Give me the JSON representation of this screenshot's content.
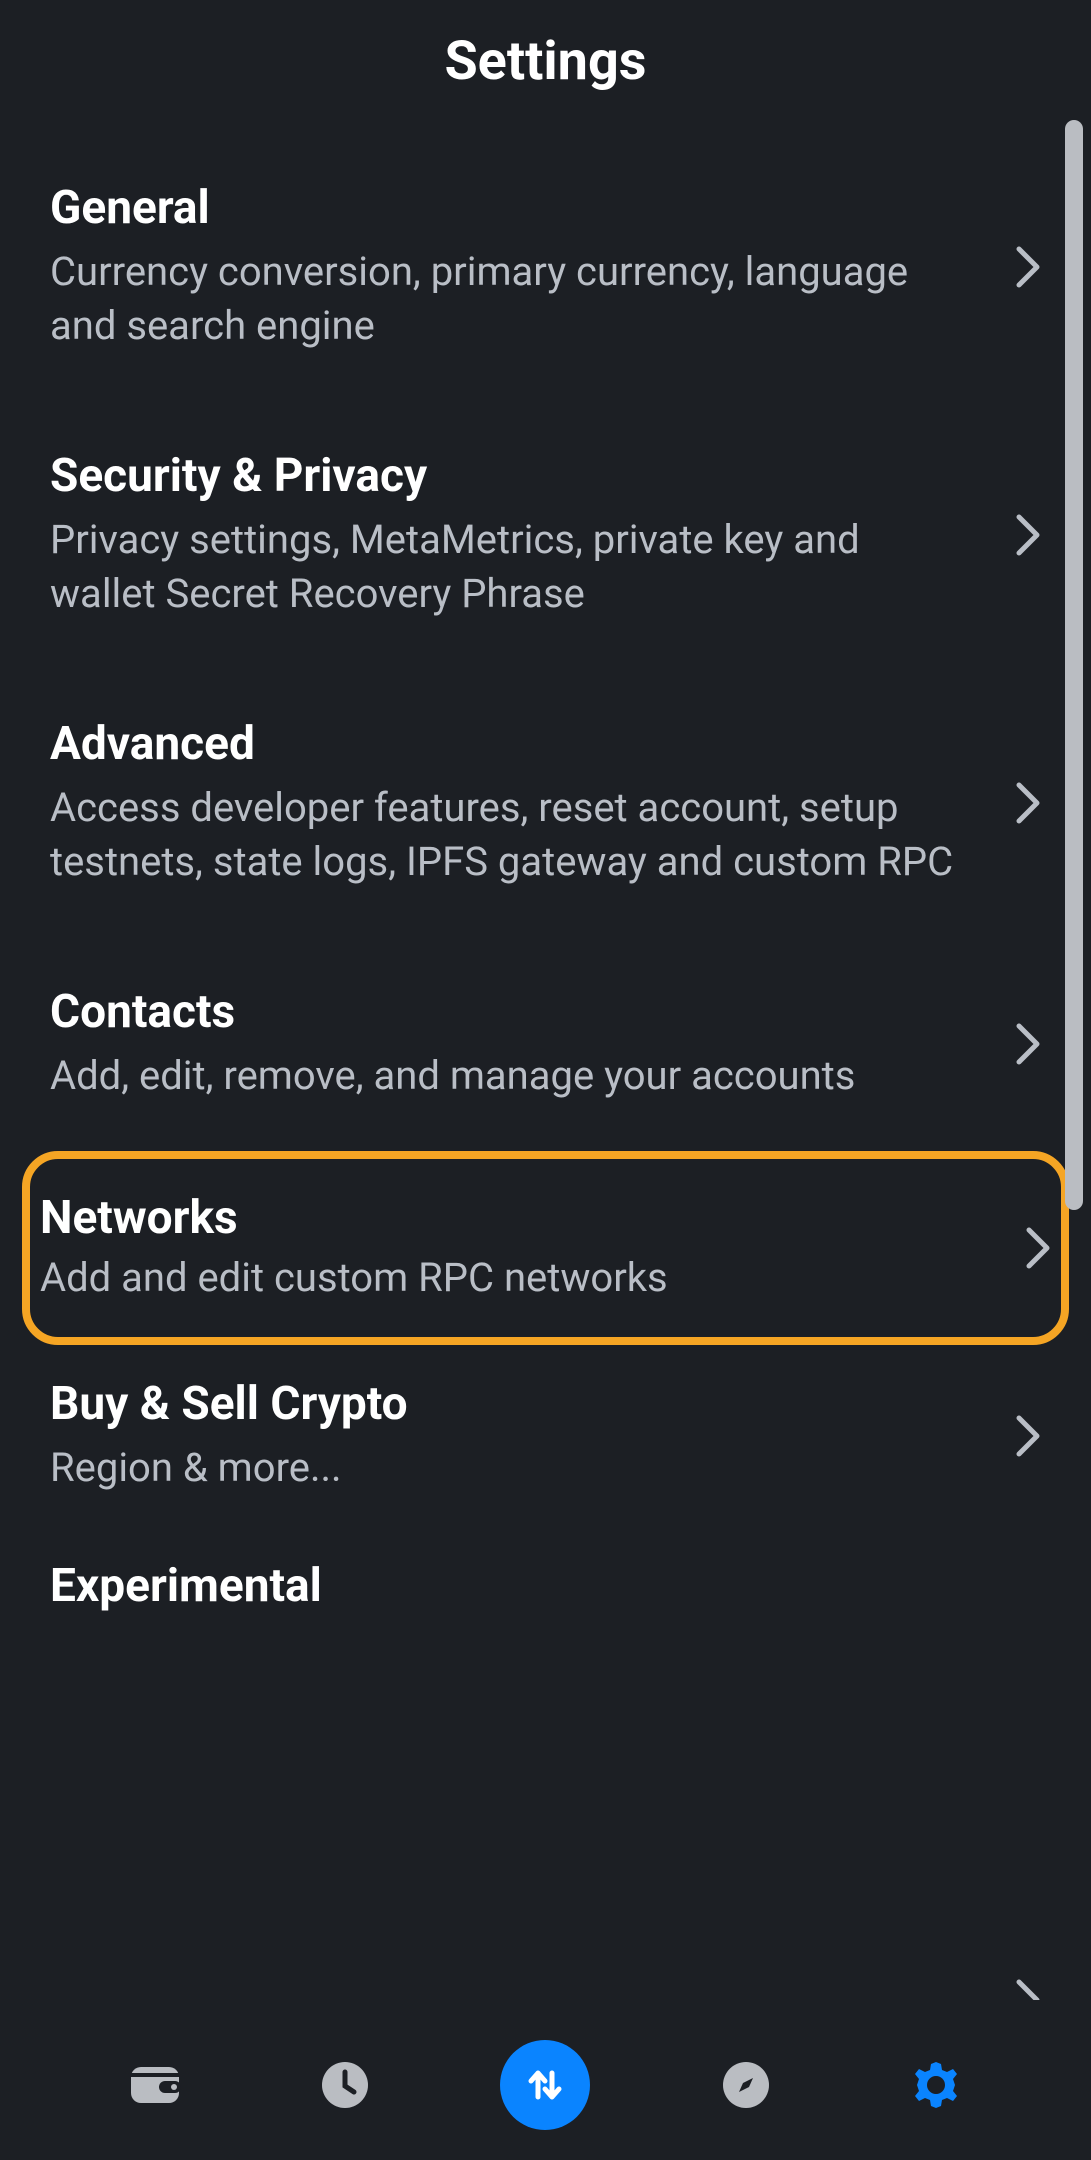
{
  "header": {
    "title": "Settings"
  },
  "items": [
    {
      "title": "General",
      "desc": "Currency conversion, primary currency, language and search engine"
    },
    {
      "title": "Security & Privacy",
      "desc": "Privacy settings, MetaMetrics, private key and wallet Secret Recovery Phrase"
    },
    {
      "title": "Advanced",
      "desc": "Access developer features, reset account, setup testnets, state logs, IPFS gateway and custom RPC"
    },
    {
      "title": "Contacts",
      "desc": "Add, edit, remove, and manage your accounts"
    },
    {
      "title": "Networks",
      "desc": "Add and edit custom RPC networks"
    },
    {
      "title": "Buy & Sell Crypto",
      "desc": "Region & more..."
    },
    {
      "title": "Experimental",
      "desc": ""
    }
  ],
  "colors": {
    "accent": "#0a84ff",
    "highlight_border": "#f5a524",
    "bg": "#1c1f24",
    "text_secondary": "#b9bec6"
  },
  "tabs": [
    {
      "name": "wallet-icon"
    },
    {
      "name": "activity-icon"
    },
    {
      "name": "swap-icon"
    },
    {
      "name": "browser-icon"
    },
    {
      "name": "settings-icon"
    }
  ]
}
